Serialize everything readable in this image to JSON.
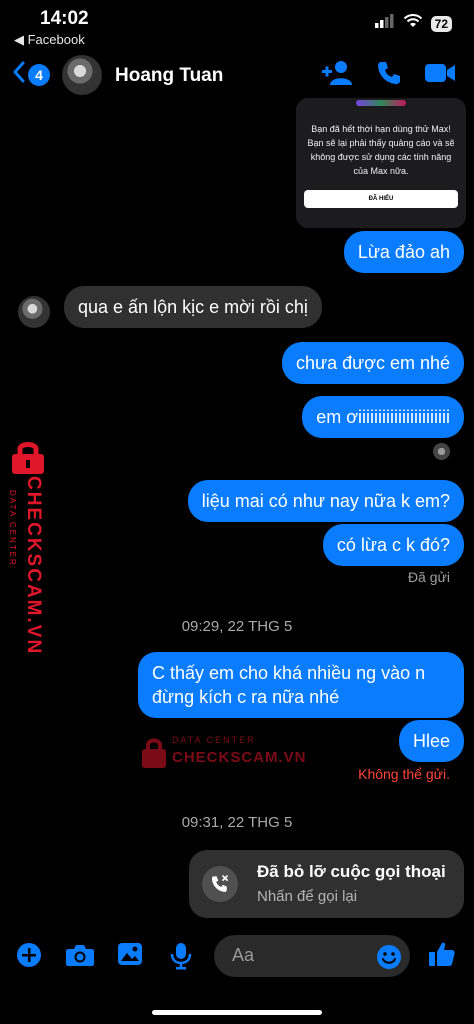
{
  "status_bar": {
    "time": "14:02",
    "back_app": "◀ Facebook",
    "battery": "72"
  },
  "header": {
    "unread_count": "4",
    "contact_name": "Hoang Tuan"
  },
  "promo_card": {
    "text": "Bạn đã hết thời hạn dùng thử Max! Bạn sẽ lại phải thấy quảng cáo và sẽ không được sử dụng các tính năng của Max nữa.",
    "button": "ĐÃ HIỂU"
  },
  "messages": [
    {
      "dir": "out",
      "text": "Lừa đảo ah"
    },
    {
      "dir": "in",
      "text": "qua e ấn lộn kịc e mời rồi chị"
    },
    {
      "dir": "out",
      "text": "chưa được em nhé"
    },
    {
      "dir": "out",
      "text": "em ơiiiiiiiiiiiiiiiiiiiiiii"
    },
    {
      "dir": "out",
      "text": "liệu mai có như nay nữa k em?"
    },
    {
      "dir": "out",
      "text": "có lừa c k đó?"
    },
    {
      "dir": "out",
      "text": "C thấy em cho khá nhiều ng vào n\nđừng kích c ra nữa nhé"
    },
    {
      "dir": "out",
      "text": "Hlee"
    }
  ],
  "statuses": {
    "sent": "Đã gửi",
    "failed": "Không thể gửi."
  },
  "timestamps": [
    "09:29, 22 THG 5",
    "09:31, 22 THG 5"
  ],
  "missed_call": {
    "title": "Đã bỏ lỡ cuộc gọi thoại",
    "subtitle": "Nhấn để gọi lại"
  },
  "composer": {
    "placeholder": "Aa"
  },
  "watermark": {
    "brand": "CHECKSCAM.VN",
    "tag": "DATA CENTER"
  },
  "colors": {
    "accent": "#0a7cff",
    "incoming": "#303030",
    "error": "#ff453a",
    "watermark": "#e0162b"
  }
}
